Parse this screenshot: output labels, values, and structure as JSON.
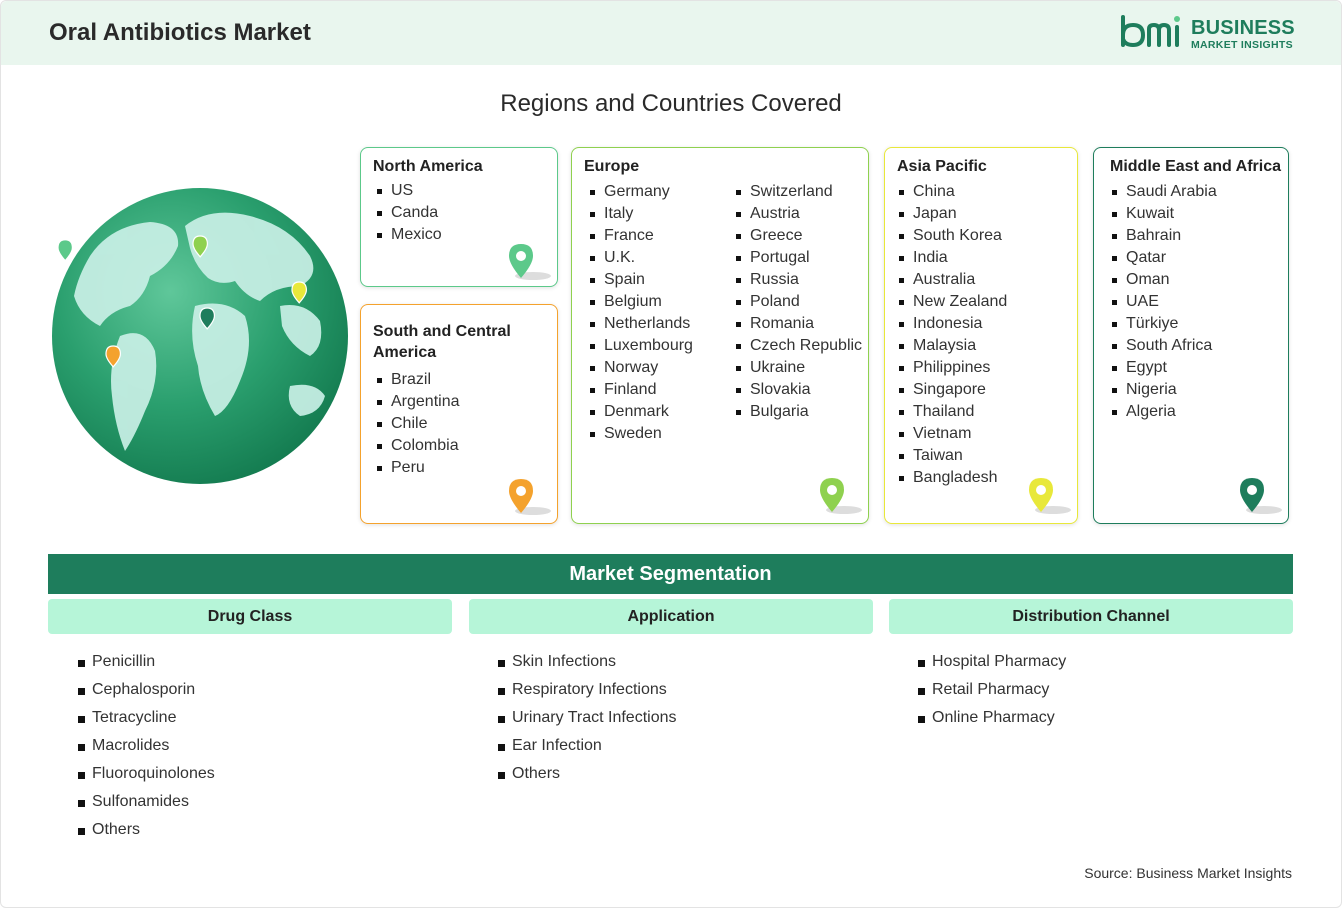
{
  "header": {
    "title": "Oral Antibiotics Market",
    "logo_line1": "BUSINESS",
    "logo_line2": "MARKET INSIGHTS"
  },
  "regions_title": "Regions and Countries Covered",
  "regions": {
    "north_america": {
      "title": "North America",
      "countries": [
        "US",
        "Canda",
        "Mexico"
      ],
      "color": "#5cc98a"
    },
    "south_america": {
      "title": "South and Central America",
      "countries": [
        "Brazil",
        "Argentina",
        "Chile",
        "Colombia",
        "Peru"
      ],
      "color": "#f4a22d"
    },
    "europe": {
      "title": "Europe",
      "countries_col1": [
        "Germany",
        "Italy",
        "France",
        "U.K.",
        "Spain",
        "Belgium",
        "Netherlands",
        "Luxembourg",
        "Norway",
        "Finland",
        "Denmark",
        "Sweden"
      ],
      "countries_col2": [
        "Switzerland",
        "Austria",
        "Greece",
        "Portugal",
        "Russia",
        "Poland",
        "Romania",
        "Czech Republic",
        "Ukraine",
        "Slovakia",
        "Bulgaria"
      ],
      "color": "#8fd14f"
    },
    "asia_pacific": {
      "title": "Asia Pacific",
      "countries": [
        "China",
        "Japan",
        "South Korea",
        "India",
        "Australia",
        "New Zealand",
        "Indonesia",
        "Malaysia",
        "Philippines",
        "Singapore",
        "Thailand",
        "Vietnam",
        "Taiwan",
        "Bangladesh"
      ],
      "color": "#e8e83a"
    },
    "mea": {
      "title": "Middle East and Africa",
      "countries": [
        "Saudi Arabia",
        "Kuwait",
        "Bahrain",
        "Qatar",
        "Oman",
        "UAE",
        "Türkiye",
        "South Africa",
        "Egypt",
        "Nigeria",
        "Algeria"
      ],
      "color": "#1e7d5c"
    }
  },
  "segmentation": {
    "title": "Market Segmentation",
    "drug_class": {
      "title": "Drug Class",
      "items": [
        "Penicillin",
        "Cephalosporin",
        "Tetracycline",
        "Macrolides",
        "Fluoroquinolones",
        "Sulfonamides",
        "Others"
      ]
    },
    "application": {
      "title": "Application",
      "items": [
        "Skin Infections",
        "Respiratory Infections",
        "Urinary Tract Infections",
        "Ear Infection",
        "Others"
      ]
    },
    "distribution": {
      "title": "Distribution Channel",
      "items": [
        "Hospital Pharmacy",
        "Retail Pharmacy",
        "Online Pharmacy"
      ]
    }
  },
  "source": "Source: Business Market Insights",
  "colors": {
    "brand": "#1e7d5c",
    "header_bg": "#e9f6ee",
    "segment_head_bg": "#b6f5d8"
  }
}
